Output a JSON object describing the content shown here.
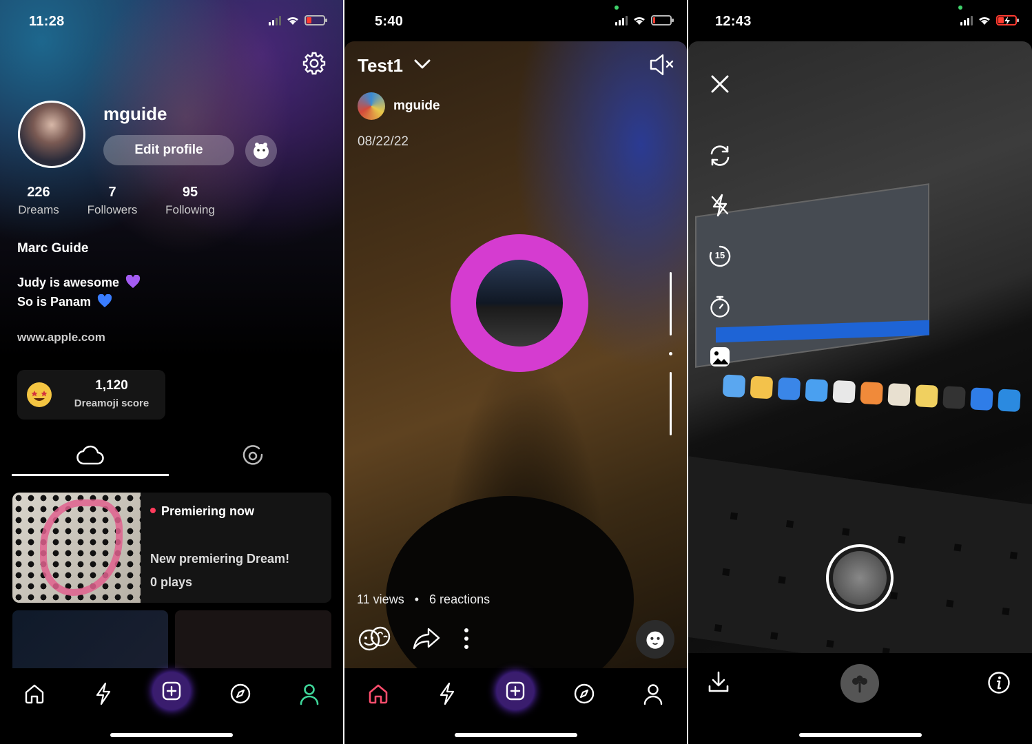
{
  "phone1": {
    "status_time": "11:28",
    "username": "mguide",
    "edit_profile_label": "Edit profile",
    "stats": [
      {
        "number": "226",
        "label": "Dreams"
      },
      {
        "number": "7",
        "label": "Followers"
      },
      {
        "number": "95",
        "label": "Following"
      }
    ],
    "full_name": "Marc Guide",
    "bio_line1": "Judy is awesome",
    "bio_line2": "So is Panam",
    "website": "www.apple.com",
    "dreamoji_score_value": "1,120",
    "dreamoji_score_label": "Dreamoji score",
    "dream_card": {
      "status": "Premiering now",
      "title": "New premiering Dream!",
      "plays": "0 plays"
    },
    "icons": [
      "gear-icon",
      "face-icon",
      "cloud-icon",
      "record-icon",
      "home-icon",
      "bolt-icon",
      "plus-icon",
      "compass-icon",
      "profile-icon"
    ],
    "colors": {
      "accent_purple": "#7d3cff",
      "active_tab": "#3fd69a",
      "heart_purple": "#a35cf2",
      "heart_blue": "#3a7dff"
    }
  },
  "phone2": {
    "status_time": "5:40",
    "dream_title": "Test1",
    "username": "mguide",
    "date": "08/22/22",
    "views": "11 views",
    "separator": "•",
    "reactions": "6 reactions",
    "icons": [
      "chevron-down-icon",
      "mute-icon",
      "reactions-icon",
      "share-icon",
      "more-icon",
      "react-face-icon",
      "home-icon",
      "bolt-icon",
      "plus-icon",
      "compass-icon",
      "profile-icon"
    ],
    "colors": {
      "active_home": "#ff4d6d",
      "ring": "#d53cd0"
    }
  },
  "phone3": {
    "status_time": "12:43",
    "timer_value": "15",
    "icons": [
      "close-icon",
      "flip-camera-icon",
      "flash-off-icon",
      "timer-15-icon",
      "stopwatch-icon",
      "gallery-icon",
      "download-icon",
      "bloom-icon",
      "info-icon"
    ],
    "colors": {
      "battery_charging": "#ff3b30"
    }
  }
}
